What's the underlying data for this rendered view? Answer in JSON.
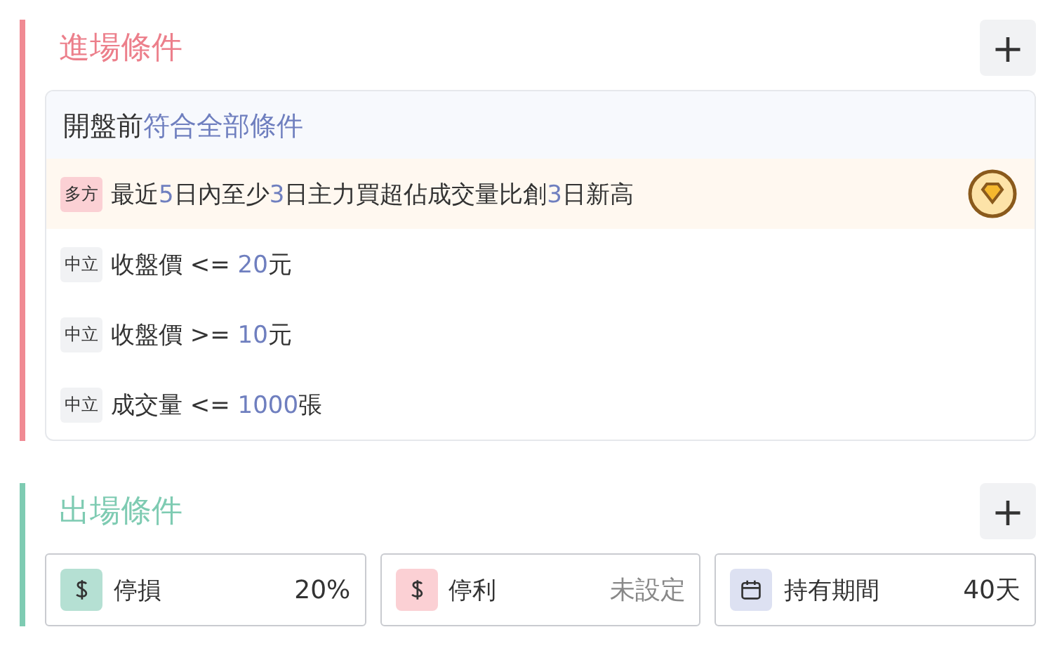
{
  "entry": {
    "title": "進場條件",
    "add_button": "+",
    "header": [
      {
        "text": "開盤前",
        "hl": false
      },
      {
        "text": "符合全部條件",
        "hl": true
      }
    ],
    "conditions": [
      {
        "tag": "多方",
        "kind": "bull",
        "highlighted": true,
        "badge": true,
        "parts": [
          {
            "text": "最近",
            "hl": false
          },
          {
            "text": "5",
            "hl": true
          },
          {
            "text": "日內至少",
            "hl": false
          },
          {
            "text": "3",
            "hl": true
          },
          {
            "text": "日主力買超佔成交量比創",
            "hl": false
          },
          {
            "text": "3",
            "hl": true
          },
          {
            "text": "日新高",
            "hl": false
          }
        ]
      },
      {
        "tag": "中立",
        "kind": "neutral",
        "highlighted": false,
        "badge": false,
        "parts": [
          {
            "text": "收盤價 <= ",
            "hl": false
          },
          {
            "text": "20",
            "hl": true
          },
          {
            "text": "元",
            "hl": false
          }
        ]
      },
      {
        "tag": "中立",
        "kind": "neutral",
        "highlighted": false,
        "badge": false,
        "parts": [
          {
            "text": "收盤價 >= ",
            "hl": false
          },
          {
            "text": "10",
            "hl": true
          },
          {
            "text": "元",
            "hl": false
          }
        ]
      },
      {
        "tag": "中立",
        "kind": "neutral",
        "highlighted": false,
        "badge": false,
        "parts": [
          {
            "text": "成交量 <= ",
            "hl": false
          },
          {
            "text": "1000",
            "hl": true
          },
          {
            "text": "張",
            "hl": false
          }
        ]
      }
    ]
  },
  "exit": {
    "title": "出場條件",
    "add_button": "+",
    "items": [
      {
        "kind": "dollar",
        "color": "#b5e0d3",
        "label": "停損",
        "value": "20%",
        "set": true
      },
      {
        "kind": "dollar",
        "color": "#fbd0d4",
        "label": "停利",
        "value": "未設定",
        "set": false
      },
      {
        "kind": "calendar",
        "color": "#dde1f2",
        "label": "持有期間",
        "value": "40天",
        "set": true
      }
    ]
  }
}
